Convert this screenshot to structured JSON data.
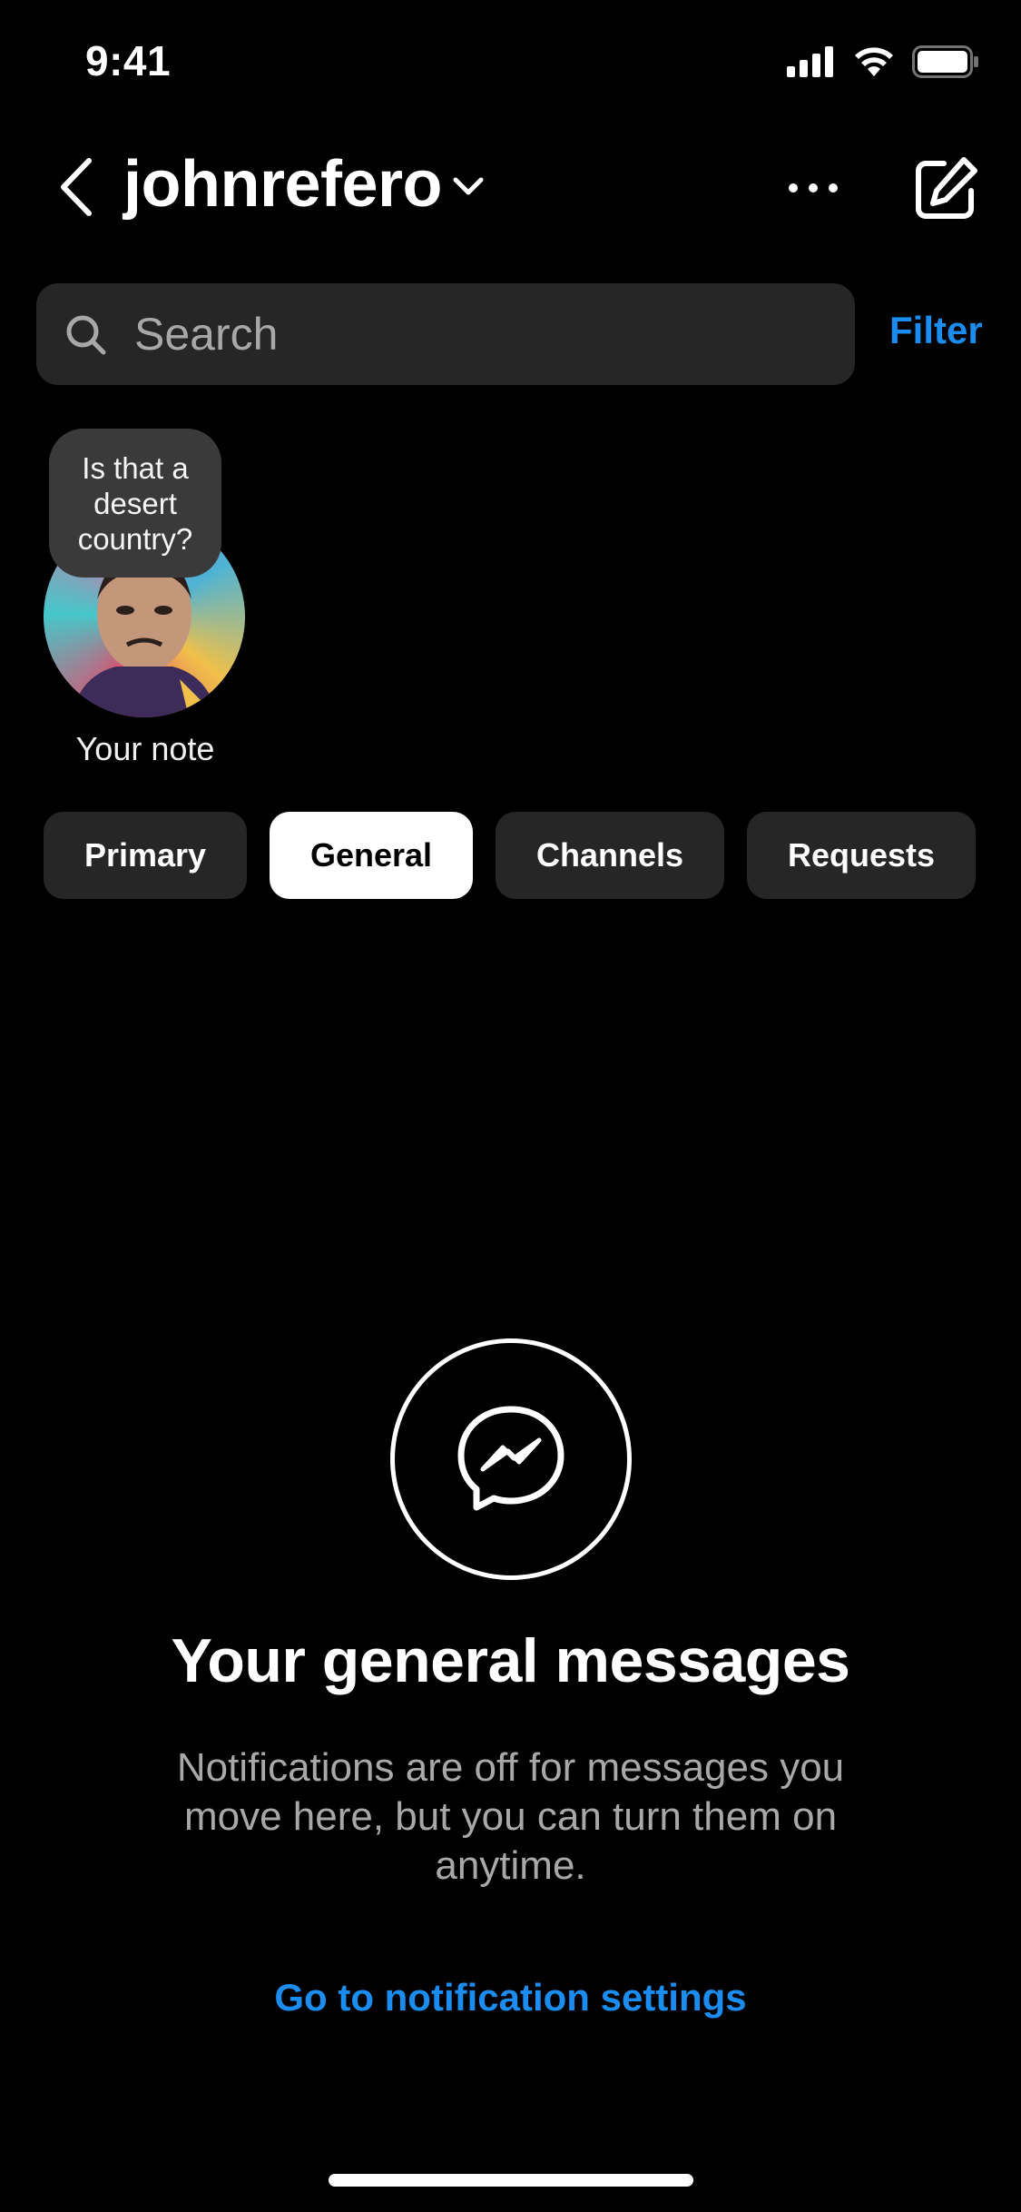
{
  "status_bar": {
    "time": "9:41",
    "icons": [
      "cellular-signal-icon",
      "wifi-icon",
      "battery-icon"
    ]
  },
  "header": {
    "account_name": "johnrefero",
    "back_icon": "chevron-left-icon",
    "account_switch_icon": "chevron-down-icon",
    "more_icon": "more-horizontal-icon",
    "compose_icon": "compose-icon"
  },
  "search": {
    "placeholder": "Search",
    "value": "",
    "filter_label": "Filter"
  },
  "note": {
    "text": "Is that a desert country?",
    "label": "Your note"
  },
  "tabs": [
    {
      "label": "Primary",
      "active": false
    },
    {
      "label": "General",
      "active": true
    },
    {
      "label": "Channels",
      "active": false
    },
    {
      "label": "Requests",
      "active": false
    }
  ],
  "empty_state": {
    "icon": "messenger-icon",
    "title": "Your general messages",
    "description": "Notifications are off for messages you move here, but you can turn them on anytime.",
    "action_label": "Go to notification settings"
  },
  "colors": {
    "background": "#000000",
    "surface": "#262626",
    "accent": "#1b8cf0",
    "secondary_text": "#a8a8a8"
  }
}
